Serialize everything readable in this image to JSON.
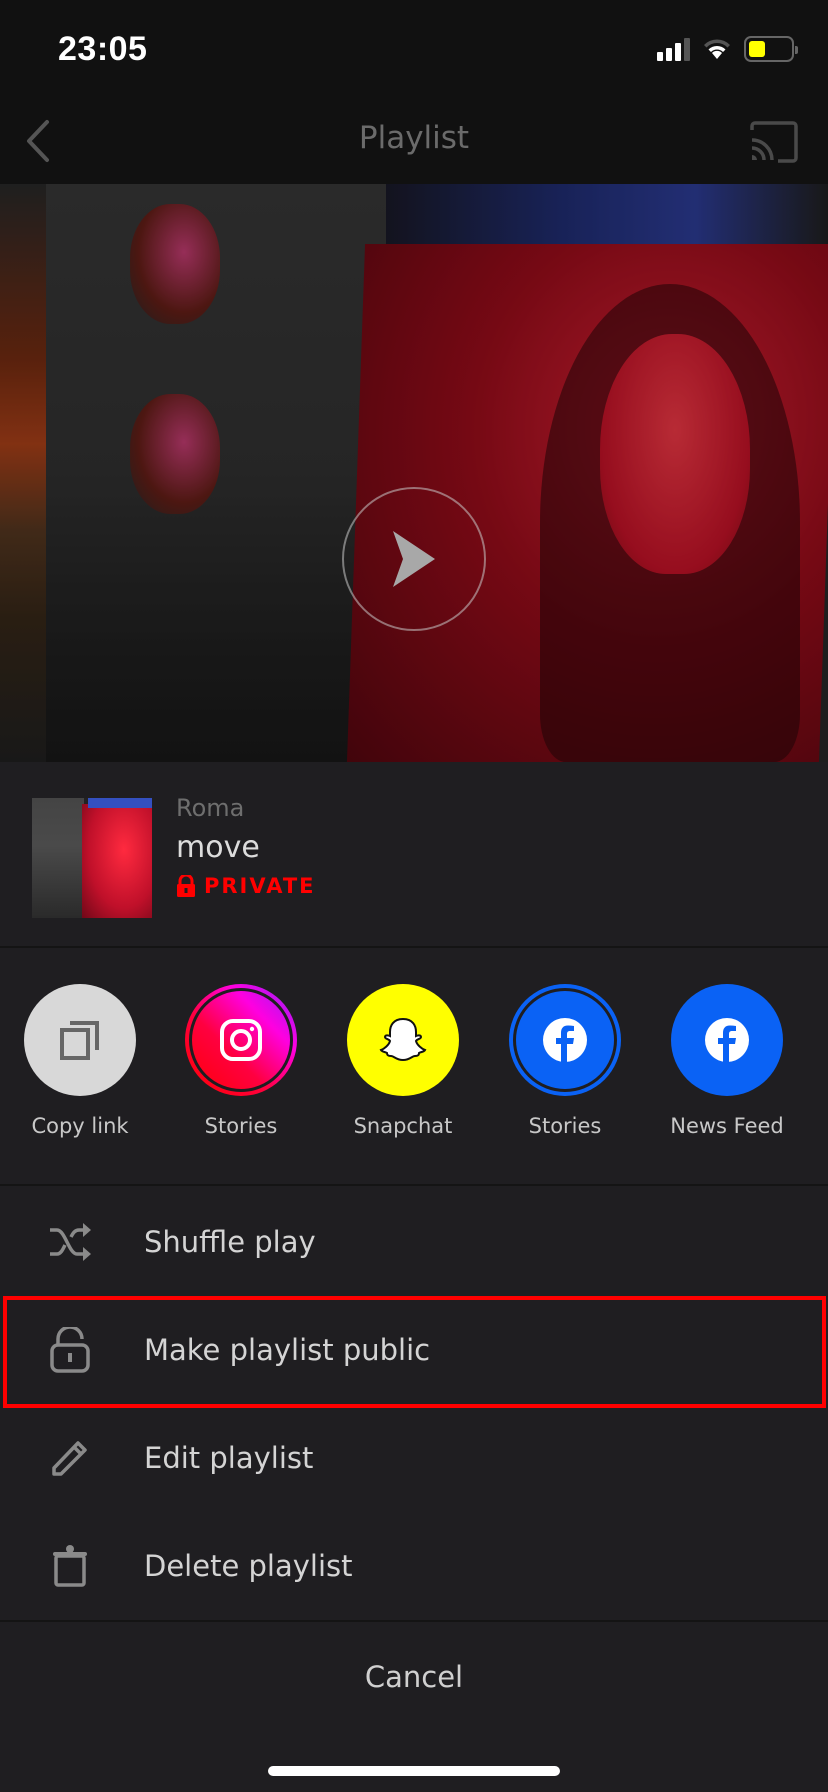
{
  "status_bar": {
    "time": "23:05",
    "signal_icon": "cellular-signal-icon",
    "wifi_icon": "wifi-icon",
    "battery_icon": "battery-icon",
    "battery_level": 0.35,
    "battery_color": "#ffff00"
  },
  "nav": {
    "title": "Playlist",
    "back_icon": "chevron-left-icon",
    "cast_icon": "cast-icon"
  },
  "hero": {
    "play_icon": "play-icon"
  },
  "playlist": {
    "owner": "Roma",
    "title": "move",
    "privacy_label": "PRIVATE",
    "privacy_icon": "lock-icon",
    "privacy_color": "#ff0000"
  },
  "share": {
    "items": [
      {
        "label": "Copy link",
        "icon": "copy-link-icon",
        "color": "#d8d8d8"
      },
      {
        "label": "Stories",
        "icon": "instagram-icon",
        "color": "#ff0050"
      },
      {
        "label": "Snapchat",
        "icon": "snapchat-icon",
        "color": "#ffff00"
      },
      {
        "label": "Stories",
        "icon": "facebook-icon",
        "color": "#0a62f5"
      },
      {
        "label": "News Feed",
        "icon": "facebook-icon",
        "color": "#0a62f5"
      }
    ]
  },
  "menu": {
    "items": [
      {
        "label": "Shuffle play",
        "icon": "shuffle-icon"
      },
      {
        "label": "Make playlist public",
        "icon": "unlock-icon",
        "highlighted": true
      },
      {
        "label": "Edit playlist",
        "icon": "pencil-icon"
      },
      {
        "label": "Delete playlist",
        "icon": "trash-icon"
      }
    ],
    "highlight_color": "#ff0000"
  },
  "cancel_label": "Cancel"
}
